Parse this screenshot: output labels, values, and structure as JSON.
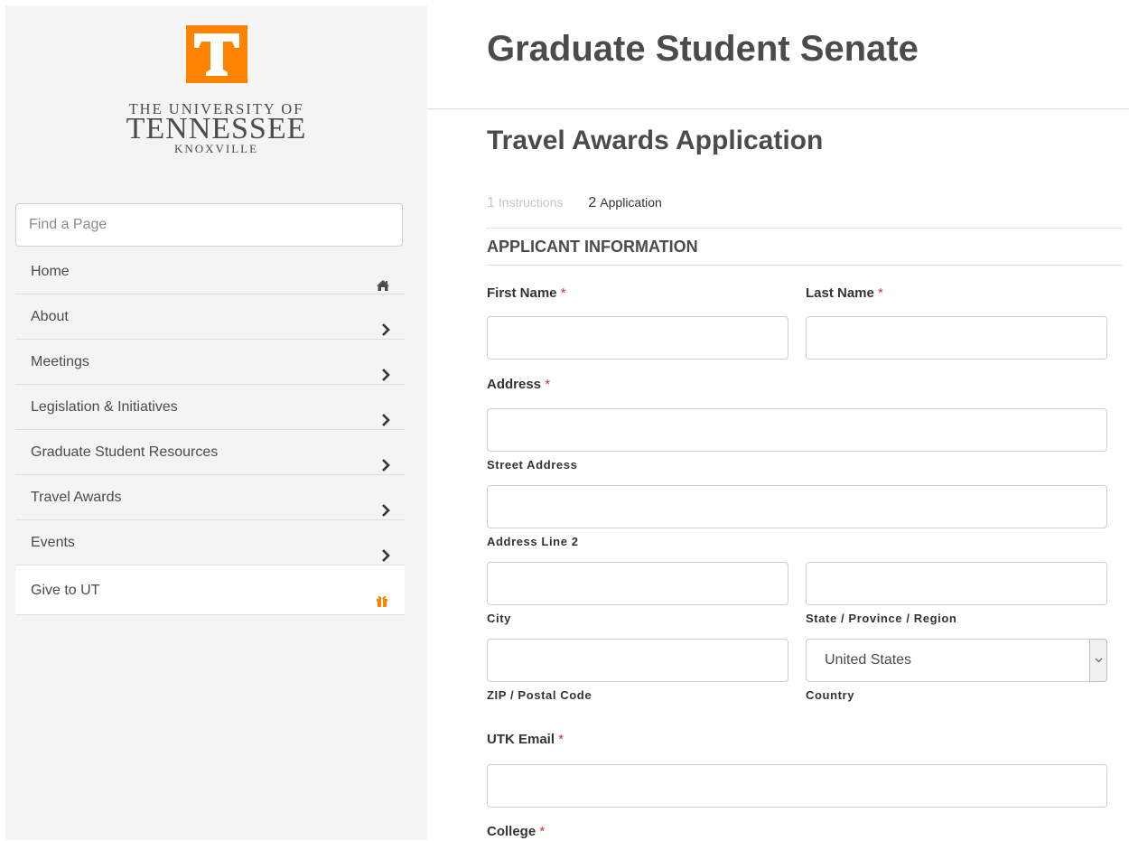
{
  "brand": {
    "logo_letter": "T",
    "logo_line1": "THE UNIVERSITY OF",
    "logo_line2": "TENNESSEE",
    "logo_line3": "KNOXVILLE",
    "accent_color": "#ff8200"
  },
  "sidebar": {
    "search_placeholder": "Find a Page",
    "items": [
      {
        "label": "Home",
        "icon": "home-icon"
      },
      {
        "label": "About",
        "icon": "chevron-right-icon"
      },
      {
        "label": "Meetings",
        "icon": "chevron-right-icon"
      },
      {
        "label": "Legislation & Initiatives",
        "icon": "chevron-right-icon"
      },
      {
        "label": "Graduate Student Resources",
        "icon": "chevron-right-icon"
      },
      {
        "label": "Travel Awards",
        "icon": "chevron-right-icon"
      },
      {
        "label": "Events",
        "icon": "chevron-right-icon"
      },
      {
        "label": "Give to UT",
        "icon": "gift-icon"
      }
    ]
  },
  "header": {
    "site_title": "Graduate Student Senate",
    "page_title": "Travel Awards Application"
  },
  "steps": [
    {
      "number": "1",
      "label": "Instructions"
    },
    {
      "number": "2",
      "label": "Application"
    }
  ],
  "form": {
    "section_title": "APPLICANT INFORMATION",
    "required_marker": "*",
    "first_name_label": "First Name",
    "last_name_label": "Last Name",
    "address_label": "Address",
    "street_address_sub": "Street Address",
    "address_line2_sub": "Address Line 2",
    "city_sub": "City",
    "state_sub": "State / Province / Region",
    "zip_sub": "ZIP / Postal Code",
    "country_sub": "Country",
    "country_value": "United States",
    "email_label": "UTK Email",
    "college_label": "College"
  }
}
